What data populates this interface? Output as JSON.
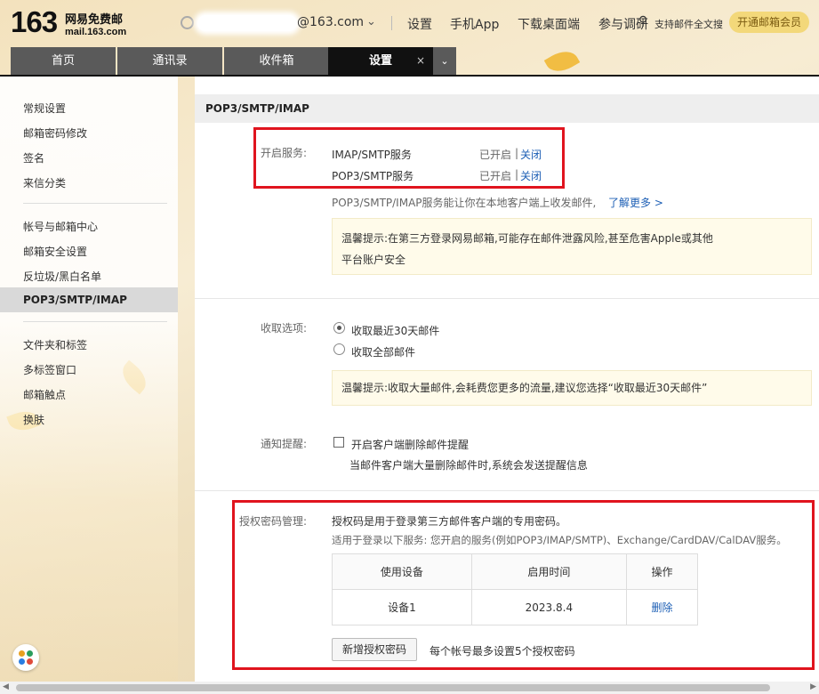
{
  "header": {
    "logo_number": "163",
    "logo_cn": "网易免费邮",
    "logo_url": "mail.163.com",
    "account_domain": "@163.com",
    "nav": [
      "设置",
      "手机App",
      "下载桌面端",
      "参与调研"
    ],
    "search_text": "支持邮件全文搜",
    "vip_label": "开通邮箱会员"
  },
  "tabs": {
    "items": [
      "首页",
      "通讯录",
      "收件箱",
      "设置"
    ],
    "active_index": 3,
    "close_glyph": "×",
    "more_glyph": "⌄"
  },
  "sidebar": {
    "groups": [
      [
        "常规设置",
        "邮箱密码修改",
        "签名",
        "来信分类"
      ],
      [
        "帐号与邮箱中心",
        "邮箱安全设置",
        "反垃圾/黑白名单",
        "POP3/SMTP/IMAP"
      ],
      [
        "文件夹和标签",
        "多标签窗口",
        "邮箱触点",
        "换肤"
      ]
    ],
    "active": "POP3/SMTP/IMAP"
  },
  "main": {
    "title": "POP3/SMTP/IMAP",
    "services": {
      "label": "开启服务:",
      "rows": [
        {
          "name": "IMAP/SMTP服务",
          "status": "已开启",
          "sep": "|",
          "action": "关闭"
        },
        {
          "name": "POP3/SMTP服务",
          "status": "已开启",
          "sep": "|",
          "action": "关闭"
        }
      ],
      "desc": "POP3/SMTP/IMAP服务能让你在本地客户端上收发邮件,",
      "learn_more": "了解更多 >",
      "tip_line1": "温馨提示:在第三方登录网易邮箱,可能存在邮件泄露风险,甚至危害Apple或其他",
      "tip_line2": "平台账户安全"
    },
    "receive": {
      "label": "收取选项:",
      "options": [
        "收取最近30天邮件",
        "收取全部邮件"
      ],
      "selected": 0,
      "tip": "温馨提示:收取大量邮件,会耗费您更多的流量,建议您选择“收取最近30天邮件”"
    },
    "notify": {
      "label": "通知提醒:",
      "checkbox_label": "开启客户端删除邮件提醒",
      "checked": false,
      "desc": "当邮件客户端大量删除邮件时,系统会发送提醒信息"
    },
    "auth": {
      "label": "授权密码管理:",
      "desc1": "授权码是用于登录第三方邮件客户端的专用密码。",
      "desc2": "适用于登录以下服务: 您开启的服务(例如POP3/IMAP/SMTP)、Exchange/CardDAV/CalDAV服务。",
      "columns": [
        "使用设备",
        "启用时间",
        "操作"
      ],
      "rows": [
        {
          "device": "设备1",
          "time": "2023.8.4",
          "action": "删除"
        }
      ],
      "add_button": "新增授权密码",
      "limit_note": "每个帐号最多设置5个授权密码"
    }
  },
  "colors": {
    "highlight_box": "#e0141e",
    "link": "#1d5fb5",
    "vip_bg": "#f3d87a"
  }
}
